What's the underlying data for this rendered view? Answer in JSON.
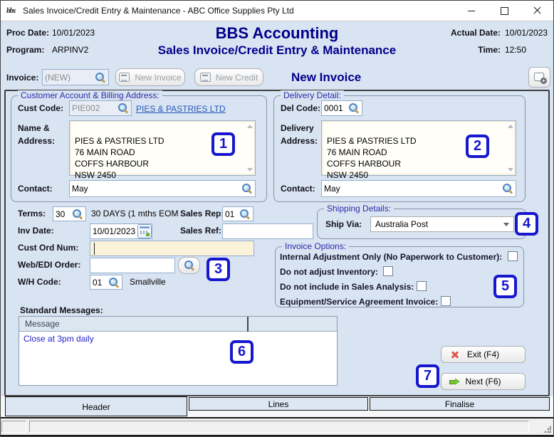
{
  "colors": {
    "window_bg": "#d9e4f2",
    "brand": "#00008b",
    "group_title": "#2b2ba6",
    "accent_link": "#2456b8",
    "annotation": "#1717d0",
    "message_text": "#2323c8",
    "highlight_field": "#faf3da"
  },
  "icons": {
    "app": "bbs-logo",
    "search": "magnifier",
    "calendar": "date-picker",
    "document_new": "document-with-pencil",
    "copy_add": "copy-document-plus",
    "exit": "red-cross",
    "next": "green-arrow"
  },
  "window": {
    "title": "Sales Invoice/Credit Entry & Maintenance - ABC Office Supplies Pty Ltd",
    "app_icon_text": "bbs"
  },
  "header": {
    "proc_date_label": "Proc Date:",
    "proc_date": "10/01/2023",
    "program_label": "Program:",
    "program": "ARPINV2",
    "app_title": "BBS Accounting",
    "screen_title": "Sales Invoice/Credit Entry & Maintenance",
    "actual_date_label": "Actual Date:",
    "actual_date": "10/01/2023",
    "time_label": "Time:",
    "time": "12:50"
  },
  "invoice_bar": {
    "label": "Invoice:",
    "number_value": "(NEW)",
    "new_invoice_btn": "New Invoice",
    "new_credit_btn": "New Credit",
    "mode_title": "New Invoice"
  },
  "customer": {
    "group_title": "Customer Account & Billing Address:",
    "cust_code_label": "Cust Code:",
    "cust_code": "PIE002",
    "account_name_link": "PIES & PASTRIES LTD",
    "name_address_label": "Name &\nAddress:",
    "address": "PIES & PASTRIES LTD\n76 MAIN ROAD\nCOFFS HARBOUR\nNSW 2450",
    "contact_label": "Contact:",
    "contact": "May"
  },
  "delivery": {
    "group_title": "Delivery Detail:",
    "del_code_label": "Del Code:",
    "del_code": "0001",
    "address_label": "Delivery\nAddress:",
    "address": "PIES & PASTRIES LTD\n76 MAIN ROAD\nCOFFS HARBOUR\nNSW 2450",
    "contact_label": "Contact:",
    "contact": "May"
  },
  "details": {
    "terms_label": "Terms:",
    "terms": "30",
    "terms_desc": "30 DAYS (1 mths EOM",
    "sales_rep_label": "Sales Rep:",
    "sales_rep": "01",
    "inv_date_label": "Inv Date:",
    "inv_date": "10/01/2023",
    "sales_ref_label": "Sales Ref:",
    "sales_ref": "",
    "cust_ord_label": "Cust Ord Num:",
    "cust_ord": "",
    "web_edi_label": "Web/EDI Order:",
    "web_edi": "",
    "wh_code_label": "W/H Code:",
    "wh_code": "01",
    "wh_name": "Smallville"
  },
  "shipping": {
    "group_title": "Shipping Details:",
    "ship_via_label": "Ship Via:",
    "ship_via": "Australia Post"
  },
  "invoice_options": {
    "group_title": "Invoice Options:",
    "options": [
      {
        "label": "Internal Adjustment Only (No Paperwork to Customer):",
        "checked": false
      },
      {
        "label": "Do not adjust Inventory:",
        "checked": false
      },
      {
        "label": "Do not include in Sales Analysis:",
        "checked": false
      },
      {
        "label": "Equipment/Service Agreement Invoice:",
        "checked": false
      }
    ]
  },
  "messages": {
    "label": "Standard Messages:",
    "column_header": "Message",
    "rows": [
      "Close at 3pm daily"
    ]
  },
  "actions": {
    "exit": "Exit (F4)",
    "next": "Next (F6)"
  },
  "tabs": [
    {
      "label": "Header",
      "active": true
    },
    {
      "label": "Lines",
      "active": false
    },
    {
      "label": "Finalise",
      "active": false
    }
  ],
  "annotations": [
    "1",
    "2",
    "3",
    "4",
    "5",
    "6",
    "7"
  ]
}
